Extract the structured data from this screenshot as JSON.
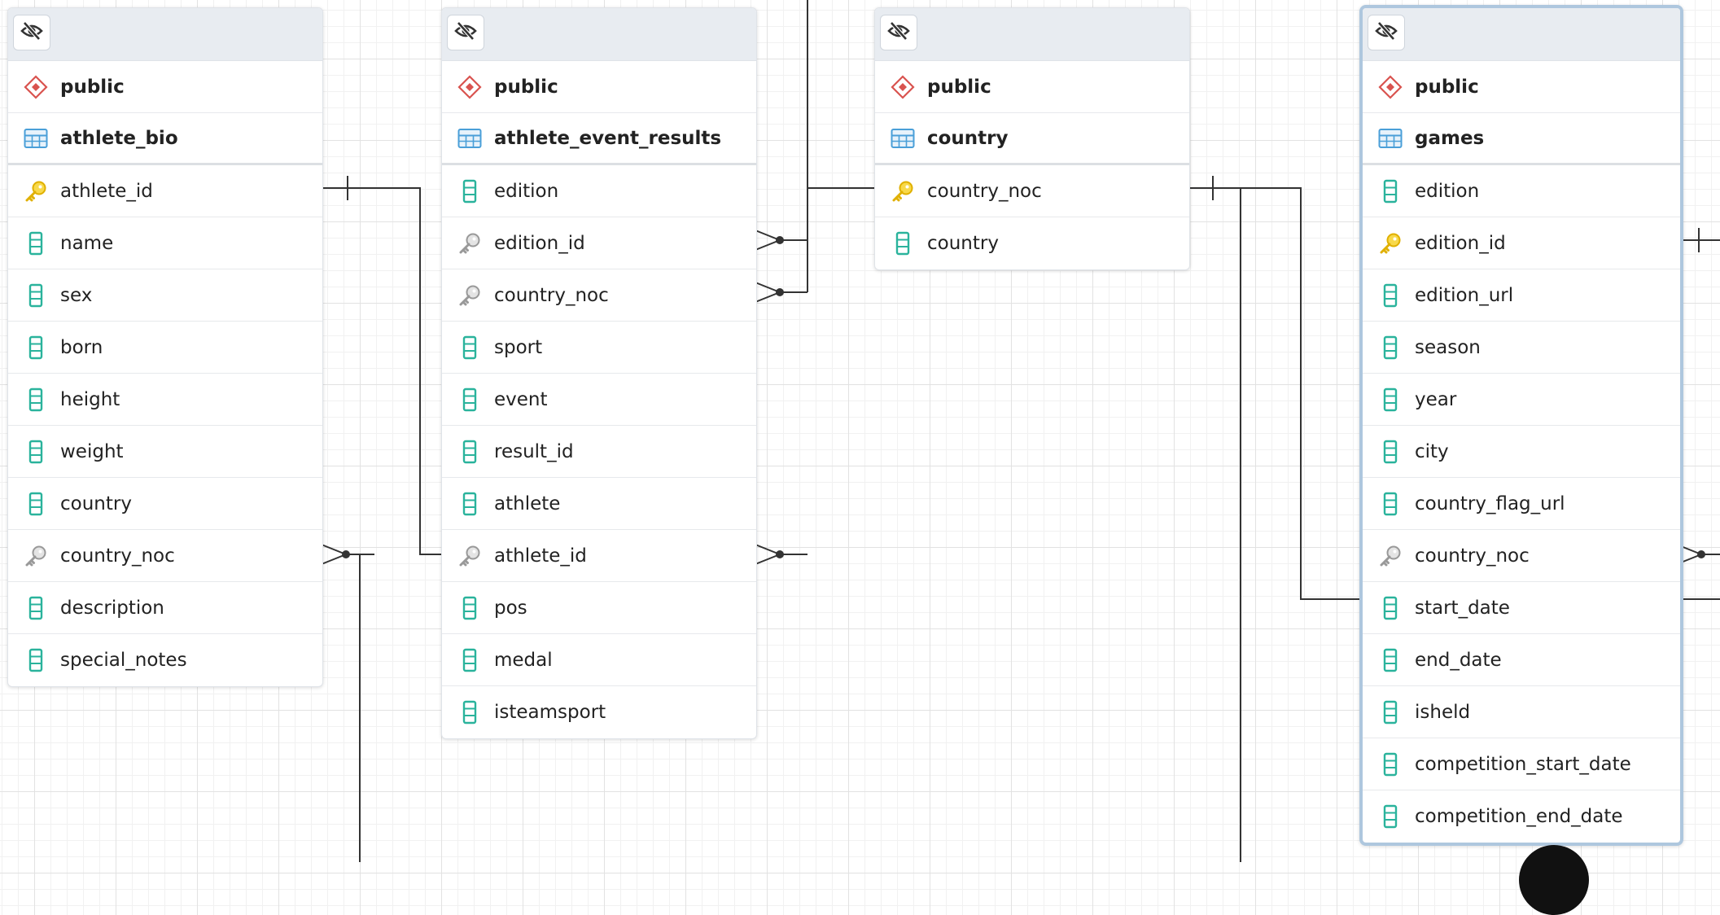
{
  "tables": [
    {
      "schema": "public",
      "name": "athlete_bio",
      "columns": [
        {
          "name": "athlete_id",
          "kind": "primary-key"
        },
        {
          "name": "name",
          "kind": "column"
        },
        {
          "name": "sex",
          "kind": "column"
        },
        {
          "name": "born",
          "kind": "column"
        },
        {
          "name": "height",
          "kind": "column"
        },
        {
          "name": "weight",
          "kind": "column"
        },
        {
          "name": "country",
          "kind": "column"
        },
        {
          "name": "country_noc",
          "kind": "foreign-key"
        },
        {
          "name": "description",
          "kind": "column"
        },
        {
          "name": "special_notes",
          "kind": "column"
        }
      ]
    },
    {
      "schema": "public",
      "name": "athlete_event_results",
      "columns": [
        {
          "name": "edition",
          "kind": "column"
        },
        {
          "name": "edition_id",
          "kind": "foreign-key"
        },
        {
          "name": "country_noc",
          "kind": "foreign-key"
        },
        {
          "name": "sport",
          "kind": "column"
        },
        {
          "name": "event",
          "kind": "column"
        },
        {
          "name": "result_id",
          "kind": "column"
        },
        {
          "name": "athlete",
          "kind": "column"
        },
        {
          "name": "athlete_id",
          "kind": "foreign-key"
        },
        {
          "name": "pos",
          "kind": "column"
        },
        {
          "name": "medal",
          "kind": "column"
        },
        {
          "name": "isteamsport",
          "kind": "column"
        }
      ]
    },
    {
      "schema": "public",
      "name": "country",
      "columns": [
        {
          "name": "country_noc",
          "kind": "primary-key"
        },
        {
          "name": "country",
          "kind": "column"
        }
      ]
    },
    {
      "schema": "public",
      "name": "games",
      "selected": true,
      "columns": [
        {
          "name": "edition",
          "kind": "column"
        },
        {
          "name": "edition_id",
          "kind": "primary-key"
        },
        {
          "name": "edition_url",
          "kind": "column"
        },
        {
          "name": "season",
          "kind": "column"
        },
        {
          "name": "year",
          "kind": "column"
        },
        {
          "name": "city",
          "kind": "column"
        },
        {
          "name": "country_flag_url",
          "kind": "column"
        },
        {
          "name": "country_noc",
          "kind": "foreign-key"
        },
        {
          "name": "start_date",
          "kind": "column"
        },
        {
          "name": "end_date",
          "kind": "column"
        },
        {
          "name": "isheld",
          "kind": "column"
        },
        {
          "name": "competition_start_date",
          "kind": "column"
        },
        {
          "name": "competition_end_date",
          "kind": "column"
        }
      ]
    }
  ],
  "colors": {
    "link": "#333333",
    "column_icon": "#2ab39c",
    "table_icon": "#4a9fd8",
    "schema_icon": "#d9534f",
    "primary_key": "#e0b000",
    "foreign_key": "#999999",
    "selection_border": "#aec7de"
  }
}
